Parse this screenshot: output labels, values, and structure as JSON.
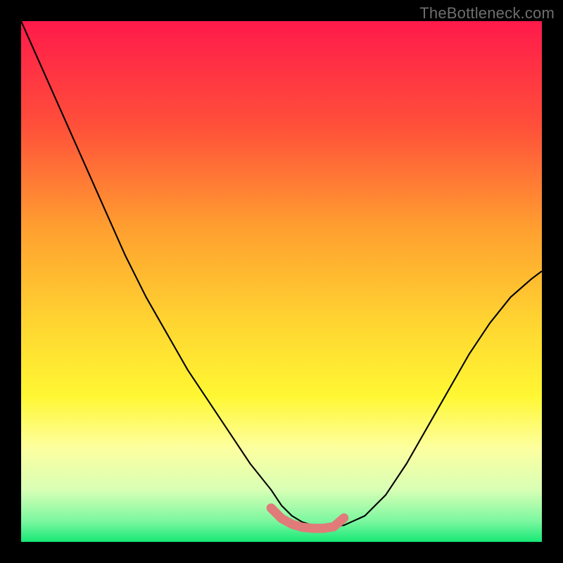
{
  "watermark": "TheBottleneck.com",
  "chart_data": {
    "type": "line",
    "title": "",
    "xlabel": "",
    "ylabel": "",
    "xlim": [
      0,
      100
    ],
    "ylim": [
      0,
      100
    ],
    "grid": false,
    "legend": false,
    "background_gradient_stops": [
      {
        "offset": 0.0,
        "color": "#ff1a4b"
      },
      {
        "offset": 0.2,
        "color": "#ff4f3a"
      },
      {
        "offset": 0.4,
        "color": "#ffa030"
      },
      {
        "offset": 0.58,
        "color": "#ffd531"
      },
      {
        "offset": 0.72,
        "color": "#fff733"
      },
      {
        "offset": 0.82,
        "color": "#fdffa0"
      },
      {
        "offset": 0.9,
        "color": "#d8ffb5"
      },
      {
        "offset": 0.96,
        "color": "#7cf7a0"
      },
      {
        "offset": 1.0,
        "color": "#17e876"
      }
    ],
    "series": [
      {
        "name": "curve",
        "stroke": "#000000",
        "stroke_width": 2.1,
        "x": [
          0,
          4,
          8,
          12,
          16,
          20,
          24,
          28,
          32,
          36,
          40,
          44,
          48,
          50,
          52,
          54,
          56,
          58,
          60,
          62,
          66,
          70,
          74,
          78,
          82,
          86,
          90,
          94,
          98,
          100
        ],
        "y": [
          100,
          91,
          82,
          73,
          64,
          55,
          47,
          40,
          33,
          27,
          21,
          15,
          10,
          7,
          5,
          3.8,
          3.2,
          3.0,
          3.0,
          3.2,
          5.0,
          9.0,
          15,
          22,
          29,
          36,
          42,
          47,
          50.5,
          52
        ]
      },
      {
        "name": "pink-band",
        "stroke": "#e07b79",
        "stroke_width": 13,
        "linecap": "round",
        "x": [
          48,
          50,
          52,
          54,
          56,
          58,
          60,
          62
        ],
        "y": [
          6.5,
          4.5,
          3.4,
          2.8,
          2.6,
          2.6,
          2.9,
          4.6
        ]
      }
    ],
    "baseline": {
      "y": 0,
      "stroke": "#17e876",
      "stroke_width": 3
    }
  }
}
